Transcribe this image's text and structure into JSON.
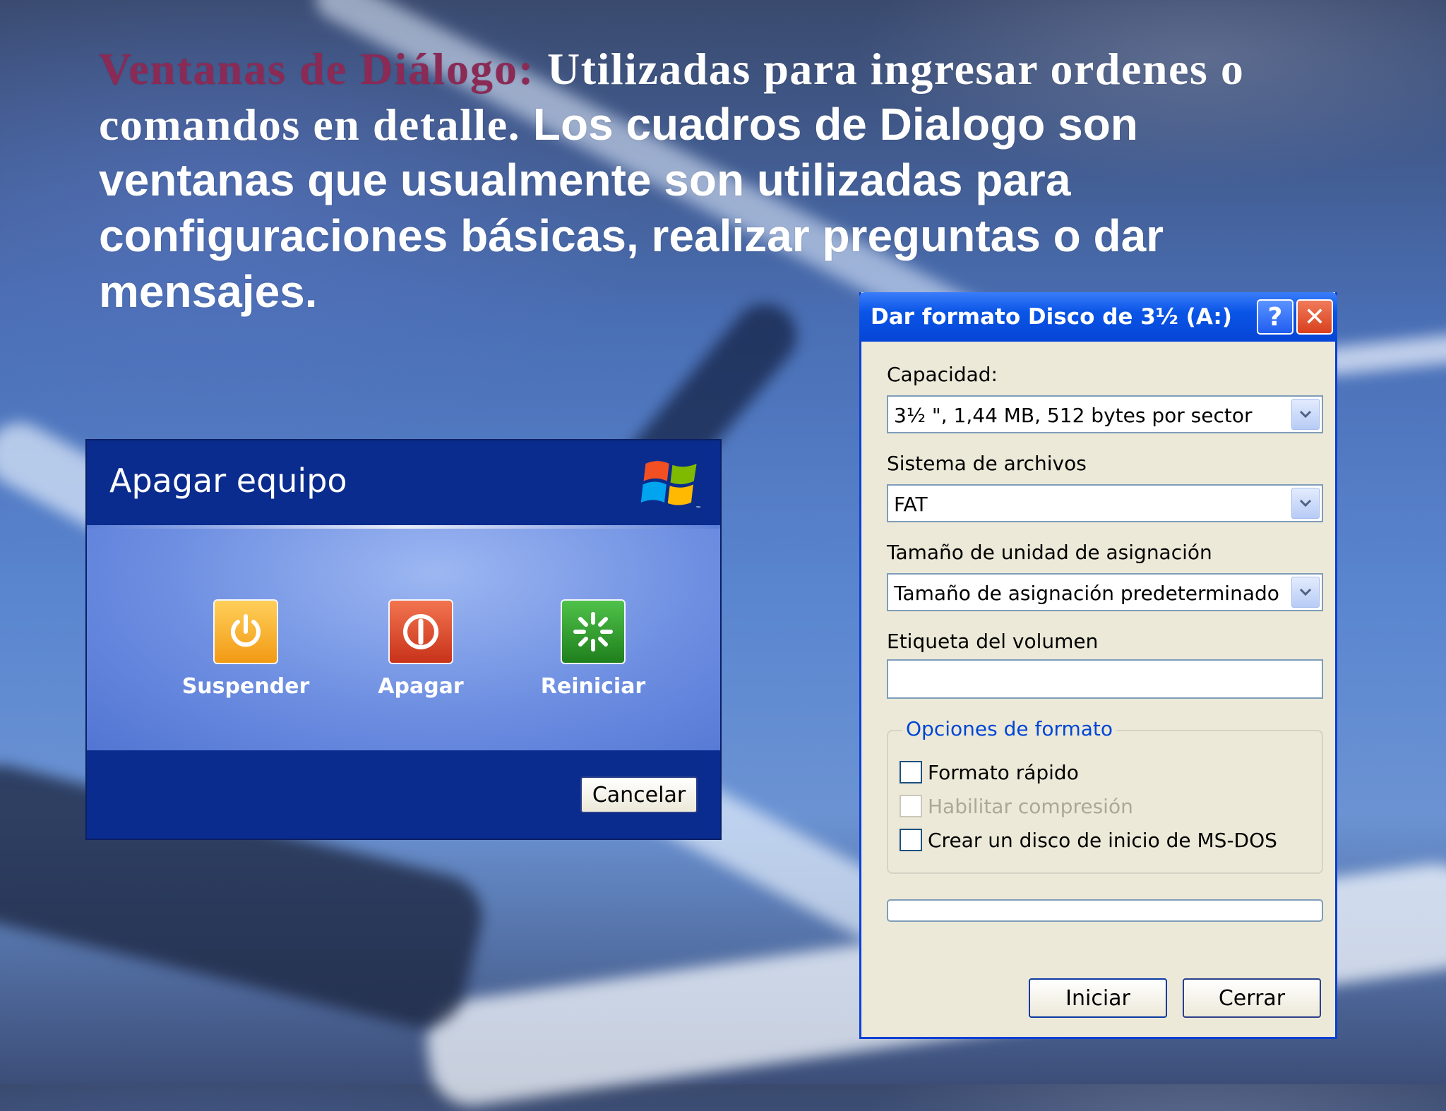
{
  "slide": {
    "heading": "Ventanas de Diálogo:",
    "line1_rest": "Utilizadas para ingresar ordenes o",
    "line2_serif": "comandos en detalle.",
    "line2_rest": "Los cuadros de Dialogo son",
    "line3": "ventanas que usualmente son utilizadas para",
    "line4": "configuraciones básicas, realizar preguntas o dar",
    "line5": "mensajes."
  },
  "shutdown_dialog": {
    "title": "Apagar equipo",
    "options": [
      {
        "label": "Suspender",
        "icon": "power-icon",
        "color": "#f6a21f"
      },
      {
        "label": "Apagar",
        "icon": "power-off-icon",
        "color": "#d9401f"
      },
      {
        "label": "Reiniciar",
        "icon": "restart-icon",
        "color": "#2d9a2a"
      }
    ],
    "cancel_label": "Cancelar"
  },
  "format_dialog": {
    "title": "Dar formato Disco de 3½ (A:)",
    "help_label": "?",
    "close_label": "✕",
    "capacity_label": "Capacidad:",
    "capacity_value": "3½ \", 1,44 MB, 512 bytes por sector",
    "filesystem_label": "Sistema de archivos",
    "filesystem_value": "FAT",
    "allocation_label": "Tamaño de unidad de asignación",
    "allocation_value": "Tamaño de asignación predeterminado",
    "volume_label": "Etiqueta del volumen",
    "volume_value": "",
    "options_group": "Opciones de formato",
    "checkboxes": [
      {
        "label": "Formato rápido",
        "checked": false,
        "enabled": true
      },
      {
        "label": "Habilitar compresión",
        "checked": false,
        "enabled": false
      },
      {
        "label": "Crear un disco de inicio de MS-DOS",
        "checked": false,
        "enabled": true
      }
    ],
    "progress": 0,
    "start_label": "Iniciar",
    "close_button_label": "Cerrar"
  }
}
